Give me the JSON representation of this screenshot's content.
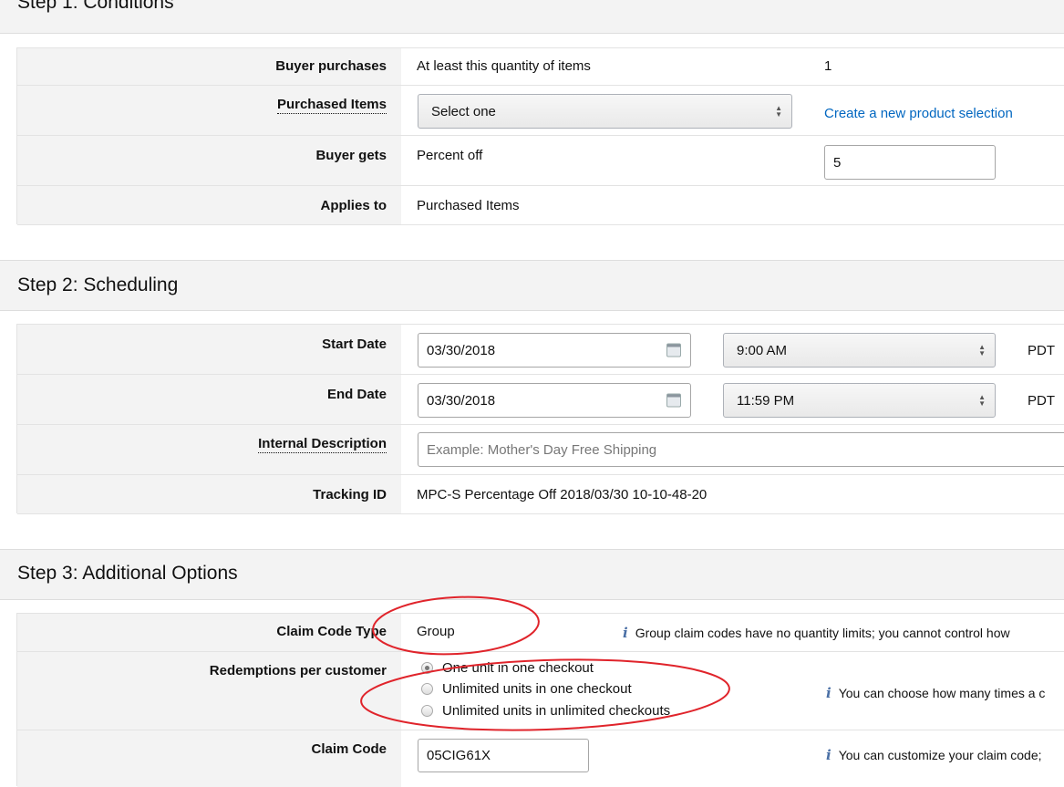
{
  "step1": {
    "title": "Step 1: Conditions",
    "buyer_purchases": {
      "label": "Buyer purchases",
      "value": "At least this quantity of items",
      "quantity": "1"
    },
    "purchased_items": {
      "label": "Purchased Items",
      "selected": "Select one",
      "link": "Create a new product selection"
    },
    "buyer_gets": {
      "label": "Buyer gets",
      "value": "Percent off",
      "amount": "5"
    },
    "applies_to": {
      "label": "Applies to",
      "value": "Purchased Items"
    }
  },
  "step2": {
    "title": "Step 2: Scheduling",
    "start_date": {
      "label": "Start Date",
      "date": "03/30/2018",
      "time": "9:00 AM",
      "tz": "PDT"
    },
    "end_date": {
      "label": "End Date",
      "date": "03/30/2018",
      "time": "11:59 PM",
      "tz": "PDT"
    },
    "internal_description": {
      "label": "Internal Description",
      "placeholder": "Example: Mother's Day Free Shipping"
    },
    "tracking_id": {
      "label": "Tracking ID",
      "value": "MPC-S Percentage Off 2018/03/30 10-10-48-20"
    }
  },
  "step3": {
    "title": "Step 3: Additional Options",
    "claim_code_type": {
      "label": "Claim Code Type",
      "value": "Group",
      "info": "Group claim codes have no quantity limits; you cannot control how"
    },
    "redemptions": {
      "label": "Redemptions per customer",
      "options": [
        "One unit in one checkout",
        "Unlimited units in one checkout",
        "Unlimited units in unlimited checkouts"
      ],
      "selected_index": 0,
      "info": "You can choose how many times a c"
    },
    "claim_code": {
      "label": "Claim Code",
      "value": "05CIG61X",
      "info": "You can customize your claim code;"
    }
  },
  "colors": {
    "annotation": "#e0242b",
    "link": "#0066c0",
    "label_bg": "#f3f3f3"
  },
  "icons": [
    "calendar-icon",
    "select-arrows-icon",
    "info-icon",
    "radio-icon"
  ]
}
